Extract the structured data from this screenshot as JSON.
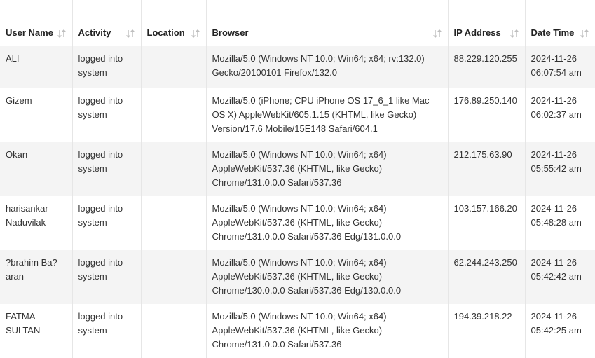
{
  "columns": [
    {
      "label": "User Name",
      "icon": "sort-icon"
    },
    {
      "label": "Activity",
      "icon": "sort-icon"
    },
    {
      "label": "Location",
      "icon": "sort-icon"
    },
    {
      "label": "Browser",
      "icon": "sort-icon"
    },
    {
      "label": "IP Address",
      "icon": "sort-icon"
    },
    {
      "label": "Date Time",
      "icon": "sort-icon"
    }
  ],
  "rows": [
    {
      "user": "ALI",
      "activity": "logged into system",
      "location": "",
      "browser": "Mozilla/5.0 (Windows NT 10.0; Win64; x64; rv:132.0) Gecko/20100101 Firefox/132.0",
      "ip": "88.229.120.255",
      "datetime": "2024-11-26 06:07:54 am"
    },
    {
      "user": "Gizem",
      "activity": "logged into system",
      "location": "",
      "browser": "Mozilla/5.0 (iPhone; CPU iPhone OS 17_6_1 like Mac OS X) AppleWebKit/605.1.15 (KHTML, like Gecko) Version/17.6 Mobile/15E148 Safari/604.1",
      "ip": "176.89.250.140",
      "datetime": "2024-11-26 06:02:37 am"
    },
    {
      "user": "Okan",
      "activity": "logged into system",
      "location": "",
      "browser": "Mozilla/5.0 (Windows NT 10.0; Win64; x64) AppleWebKit/537.36 (KHTML, like Gecko) Chrome/131.0.0.0 Safari/537.36",
      "ip": "212.175.63.90",
      "datetime": "2024-11-26 05:55:42 am"
    },
    {
      "user": "harisankar Naduvilak",
      "activity": "logged into system",
      "location": "",
      "browser": "Mozilla/5.0 (Windows NT 10.0; Win64; x64) AppleWebKit/537.36 (KHTML, like Gecko) Chrome/131.0.0.0 Safari/537.36 Edg/131.0.0.0",
      "ip": "103.157.166.20",
      "datetime": "2024-11-26 05:48:28 am"
    },
    {
      "user": "?brahim Ba?aran",
      "activity": "logged into system",
      "location": "",
      "browser": "Mozilla/5.0 (Windows NT 10.0; Win64; x64) AppleWebKit/537.36 (KHTML, like Gecko) Chrome/130.0.0.0 Safari/537.36 Edg/130.0.0.0",
      "ip": "62.244.243.250",
      "datetime": "2024-11-26 05:42:42 am"
    },
    {
      "user": "FATMA SULTAN",
      "activity": "logged into system",
      "location": "",
      "browser": "Mozilla/5.0 (Windows NT 10.0; Win64; x64) AppleWebKit/537.36 (KHTML, like Gecko) Chrome/131.0.0.0 Safari/537.36",
      "ip": "194.39.218.22",
      "datetime": "2024-11-26 05:42:25 am"
    }
  ]
}
